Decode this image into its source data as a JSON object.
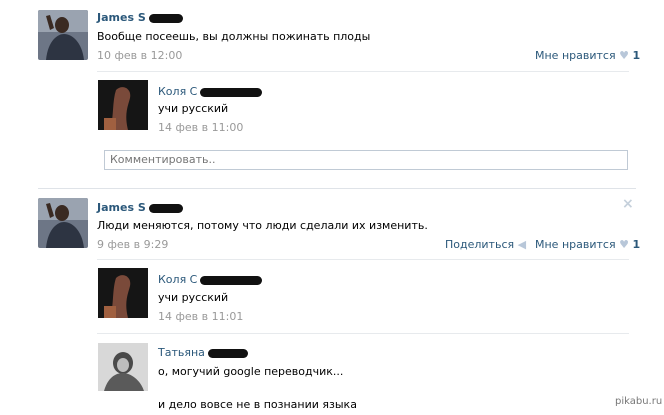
{
  "post1": {
    "author": "James S",
    "text": "Вообще посеешь, вы должны пожинать плоды",
    "time": "10 фев в 12:00",
    "like_label": "Мне нравится",
    "like_count": "1",
    "reply": {
      "name": "Коля С",
      "text": "учи русский",
      "time": "14 фев в 11:00"
    },
    "comment_placeholder": "Комментировать.."
  },
  "post2": {
    "author": "James S",
    "text": "Люди меняются, потому что люди сделали их изменить.",
    "time": "9 фев в 9:29",
    "share_label": "Поделиться",
    "like_label": "Мне нравится",
    "like_count": "1",
    "close_icon": "×",
    "replies": [
      {
        "name": "Коля С",
        "text": "учи русский",
        "time": "14 фев в 11:01"
      },
      {
        "name": "Татьяна",
        "text": "о, могучий google переводчик...",
        "text2": "и дело вовсе не в познании языка"
      }
    ]
  },
  "watermark": "pikabu.ru"
}
